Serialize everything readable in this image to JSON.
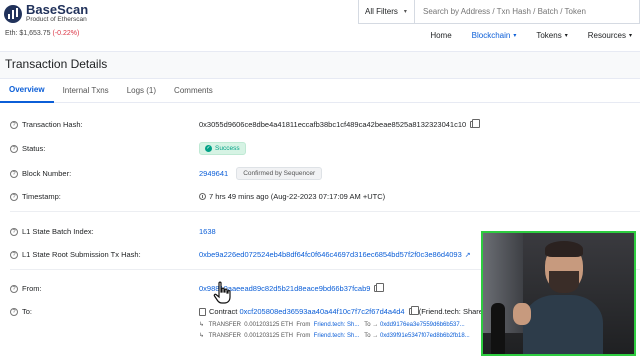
{
  "header": {
    "brand": "BaseScan",
    "brand_sub": "Product of Etherscan",
    "eth_price": "Eth: $1,653.75",
    "eth_change": "(-0.22%)",
    "filter_label": "All Filters",
    "search_placeholder": "Search by Address / Txn Hash / Batch / Token",
    "nav": [
      "Home",
      "Blockchain",
      "Tokens",
      "Resources"
    ]
  },
  "page": {
    "title": "Transaction Details",
    "tabs": [
      "Overview",
      "Internal Txns",
      "Logs (1)",
      "Comments"
    ],
    "active_tab": "Overview"
  },
  "details": {
    "tx_hash_label": "Transaction Hash:",
    "tx_hash": "0x3055d9606ce8dbe4a41811eccafb38bc1cf489ca42beae8525a8132323041c10",
    "status_label": "Status:",
    "status": "Success",
    "block_label": "Block Number:",
    "block": "2949641",
    "block_badge": "Confirmed by Sequencer",
    "timestamp_label": "Timestamp:",
    "timestamp": "7 hrs 49 mins ago (Aug-22-2023 07:17:09 AM +UTC)",
    "l1_batch_label": "L1 State Batch Index:",
    "l1_batch": "1638",
    "l1_root_label": "L1 State Root Submission Tx Hash:",
    "l1_root": "0xbe9a226ed072524eb4b8df64fc0f646c4697d316ec6854bd57f2f0c3e86d4093",
    "from_label": "From:",
    "from": "0x98810aaeead89c82d5b21d8eace9bd66b37fcab9",
    "to_label": "To:",
    "to_prefix": "Contract",
    "to_address": "0xcf205808ed36593aa40a44f10c7f7c2f67d4a4d4",
    "to_name": "(Friend.tech: Share",
    "transfers": [
      {
        "label": "TRANSFER",
        "amount": "0.001203125 ETH",
        "from_word": "From",
        "from": "Friend.tech: Sh...",
        "to_word": "To",
        "to": "0xdd9176ea3e7559d6b6b537..."
      },
      {
        "label": "TRANSFER",
        "amount": "0.001203125 ETH",
        "from_word": "From",
        "from": "Friend.tech: Sh...",
        "to_word": "To",
        "to": "0xd39f91e5347f07ed8b6b2fb18..."
      }
    ]
  },
  "colors": {
    "accent": "#0b5ed7",
    "success": "#00a186",
    "negative": "#dc3545",
    "video_border": "#2ecc40"
  }
}
